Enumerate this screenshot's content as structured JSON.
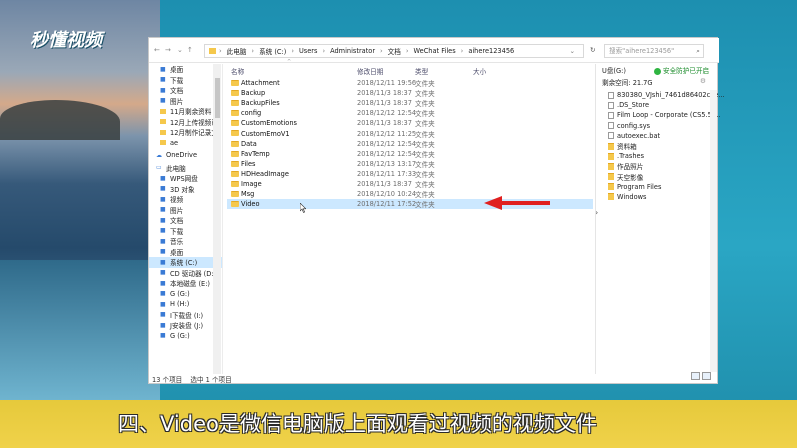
{
  "logo_text": "秒懂视频",
  "address": {
    "crumbs": [
      "此电脑",
      "系统 (C:)",
      "Users",
      "Administrator",
      "文档",
      "WeChat Files",
      "aihere123456"
    ],
    "search_placeholder": "搜索\"aihere123456\""
  },
  "sidebar": {
    "items": [
      {
        "label": "桌面",
        "pinned": true,
        "type": "quick"
      },
      {
        "label": "下载",
        "pinned": true,
        "type": "quick"
      },
      {
        "label": "文档",
        "pinned": true,
        "type": "quick"
      },
      {
        "label": "图片",
        "pinned": true,
        "type": "quick"
      },
      {
        "label": "11月剩余资料",
        "pinned": false,
        "type": "folder"
      },
      {
        "label": "12月上传视频已",
        "pinned": false,
        "type": "folder"
      },
      {
        "label": "12月制作记录文",
        "pinned": false,
        "type": "folder"
      },
      {
        "label": "ae",
        "pinned": false,
        "type": "folder"
      },
      {
        "label": "OneDrive",
        "pinned": false,
        "type": "group"
      },
      {
        "label": "此电脑",
        "pinned": false,
        "type": "group"
      },
      {
        "label": "WPS网盘",
        "pinned": false,
        "type": "sub"
      },
      {
        "label": "3D 对象",
        "pinned": false,
        "type": "sub"
      },
      {
        "label": "视频",
        "pinned": false,
        "type": "sub"
      },
      {
        "label": "图片",
        "pinned": false,
        "type": "sub"
      },
      {
        "label": "文档",
        "pinned": false,
        "type": "sub"
      },
      {
        "label": "下载",
        "pinned": false,
        "type": "sub"
      },
      {
        "label": "音乐",
        "pinned": false,
        "type": "sub"
      },
      {
        "label": "桌面",
        "pinned": false,
        "type": "sub"
      },
      {
        "label": "系统 (C:)",
        "pinned": false,
        "type": "sub",
        "selected": true
      },
      {
        "label": "CD 驱动器 (D:) I",
        "pinned": false,
        "type": "sub"
      },
      {
        "label": "本地磁盘 (E:)",
        "pinned": false,
        "type": "sub"
      },
      {
        "label": "G (G:)",
        "pinned": false,
        "type": "sub"
      },
      {
        "label": "H (H:)",
        "pinned": false,
        "type": "sub"
      },
      {
        "label": "I下载盘 (I:)",
        "pinned": false,
        "type": "sub"
      },
      {
        "label": "J安装盘 (J:)",
        "pinned": false,
        "type": "sub"
      },
      {
        "label": "G (G:)",
        "pinned": false,
        "type": "sub"
      }
    ]
  },
  "columns": {
    "name": "名称",
    "date": "修改日期",
    "type": "类型",
    "size": "大小"
  },
  "files": [
    {
      "name": "Attachment",
      "date": "2018/12/11 19:56",
      "type": "文件夹"
    },
    {
      "name": "Backup",
      "date": "2018/11/3 18:37",
      "type": "文件夹"
    },
    {
      "name": "BackupFiles",
      "date": "2018/11/3 18:37",
      "type": "文件夹"
    },
    {
      "name": "config",
      "date": "2018/12/12 12:54",
      "type": "文件夹"
    },
    {
      "name": "CustomEmotions",
      "date": "2018/11/3 18:37",
      "type": "文件夹"
    },
    {
      "name": "CustomEmoV1",
      "date": "2018/12/12 11:25",
      "type": "文件夹"
    },
    {
      "name": "Data",
      "date": "2018/12/12 12:54",
      "type": "文件夹"
    },
    {
      "name": "FavTemp",
      "date": "2018/12/12 12:54",
      "type": "文件夹"
    },
    {
      "name": "Files",
      "date": "2018/12/13 13:17",
      "type": "文件夹"
    },
    {
      "name": "HDHeadImage",
      "date": "2018/12/11 17:33",
      "type": "文件夹"
    },
    {
      "name": "Image",
      "date": "2018/11/3 18:37",
      "type": "文件夹"
    },
    {
      "name": "Msg",
      "date": "2018/12/10 10:24",
      "type": "文件夹"
    },
    {
      "name": "Video",
      "date": "2018/12/11 17:52",
      "type": "文件夹",
      "selected": true
    }
  ],
  "preview": {
    "drive_label": "U盘(G:)",
    "security": "安全防护已开启",
    "free_label": "剩余空间: 21.7G",
    "items": [
      {
        "name": "830380_VJshi_7461d86402cde...",
        "kind": "file"
      },
      {
        "name": ".DS_Store",
        "kind": "file"
      },
      {
        "name": "Film Loop - Corporate (CS5.5)...",
        "kind": "file"
      },
      {
        "name": "config.sys",
        "kind": "file"
      },
      {
        "name": "autoexec.bat",
        "kind": "file"
      },
      {
        "name": "资料箱",
        "kind": "folder"
      },
      {
        "name": ".Trashes",
        "kind": "folder"
      },
      {
        "name": "作品照片",
        "kind": "folder"
      },
      {
        "name": "天空影像",
        "kind": "folder"
      },
      {
        "name": "Program Files",
        "kind": "folder"
      },
      {
        "name": "Windows",
        "kind": "folder"
      }
    ]
  },
  "status": {
    "count": "13 个项目",
    "selected": "选中 1 个项目"
  },
  "subtitle": "四、Video是微信电脑版上面观看过视频的视频文件",
  "colors": {
    "highlight": "#cce8ff",
    "arrow": "#e02020",
    "subtitle_bar": "#ecd042",
    "folder": "#f5c84c"
  }
}
